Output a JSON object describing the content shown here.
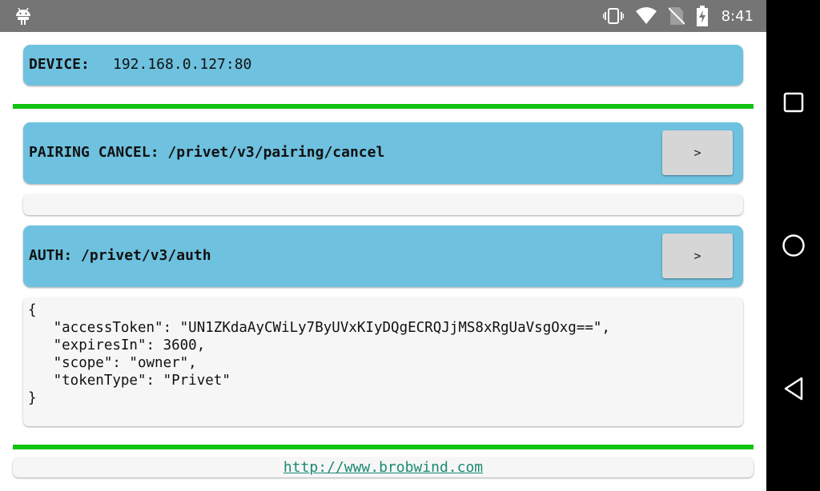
{
  "status_bar": {
    "time": "8:41",
    "icons": [
      "android-icon",
      "vibrate-icon",
      "wifi-icon",
      "no-sim-icon",
      "battery-charging-icon"
    ]
  },
  "device": {
    "label": "DEVICE:",
    "value": "192.168.0.127:80"
  },
  "pairing_cancel": {
    "label": "PAIRING CANCEL: /privet/v3/pairing/cancel",
    "button": ">",
    "output": ""
  },
  "auth": {
    "label": "AUTH: /privet/v3/auth",
    "button": ">",
    "output": "{\n   \"accessToken\": \"UN1ZKdaAyCWiLy7ByUVxKIyDQgECRQJjMS8xRgUaVsgOxg==\",\n   \"expiresIn\": 3600,\n   \"scope\": \"owner\",\n   \"tokenType\": \"Privet\"\n}"
  },
  "footer": {
    "link": "http://www.brobwind.com"
  },
  "nav_bar": {
    "icons": [
      "recents-square-icon",
      "home-circle-icon",
      "back-triangle-icon"
    ]
  },
  "colors": {
    "card_blue": "#6ec1df",
    "divider_green": "#12c312",
    "status_bar": "#757575",
    "nav_bar": "#000000",
    "link": "#1a8a72"
  }
}
